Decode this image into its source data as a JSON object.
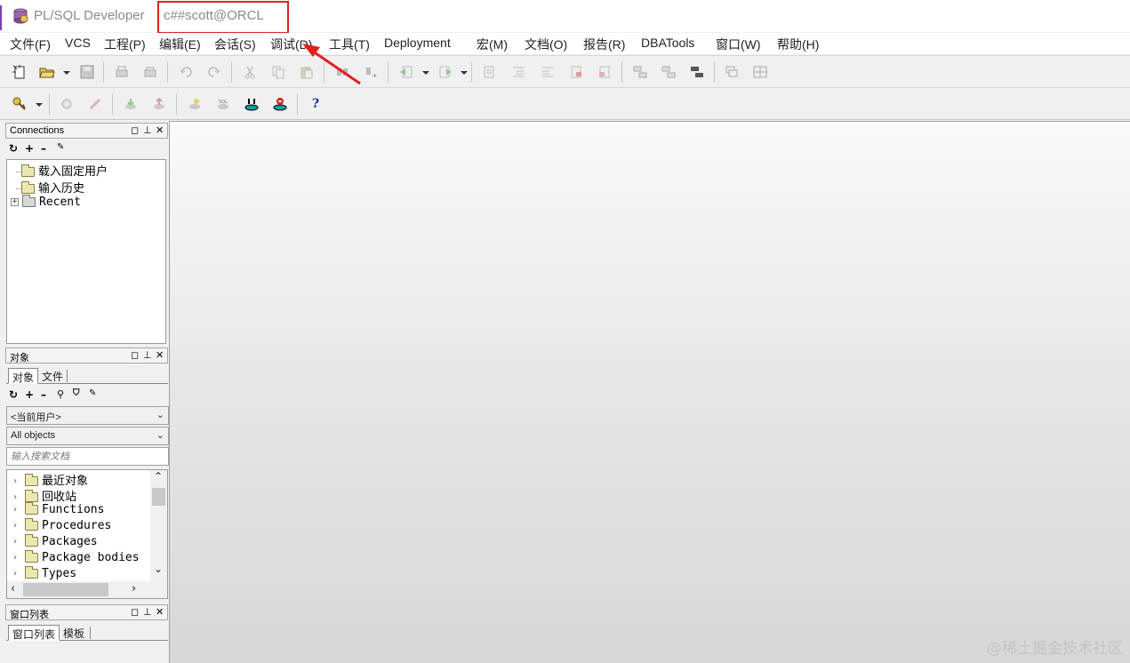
{
  "title_bar": {
    "app_title": "PL/SQL Developer",
    "connection": "c##scott@ORCL",
    "highlight_color": "#e02020"
  },
  "menu": [
    {
      "label": "文件(F)"
    },
    {
      "label": "VCS"
    },
    {
      "label": "工程(P)"
    },
    {
      "label": "编辑(E)"
    },
    {
      "label": "会话(S)"
    },
    {
      "label": "调试(D)"
    },
    {
      "label": "工具(T)"
    },
    {
      "label": "Deployment"
    },
    {
      "label": "宏(M)"
    },
    {
      "label": "文档(O)"
    },
    {
      "label": "报告(R)"
    },
    {
      "label": "DBATools"
    },
    {
      "label": "窗口(W)"
    },
    {
      "label": "帮助(H)"
    }
  ],
  "toolbar_icons": {
    "row1": [
      "new-icon",
      "open-icon",
      "save-icon",
      "print-icon",
      "print-preview-icon",
      "undo-icon",
      "redo-icon",
      "cut-icon",
      "copy-icon",
      "paste-icon",
      "find-icon",
      "replace-icon",
      "back-icon",
      "forward-icon",
      "document-icons",
      "window-icons"
    ],
    "row2": [
      "key-icon",
      "execute-icon",
      "break-icon",
      "commit-icon",
      "rollback-icon",
      "explain-icon",
      "sql-icon",
      "connect-icon",
      "disconnect-icon",
      "help-icon"
    ],
    "help_glyph": "?"
  },
  "connections_panel": {
    "title": "Connections",
    "controls": [
      "◻",
      "⊥",
      "✕"
    ],
    "items": [
      {
        "label": "载入固定用户",
        "type": "folder"
      },
      {
        "label": "输入历史",
        "type": "folder"
      },
      {
        "label": "Recent",
        "type": "folder-gray",
        "expander": "+"
      }
    ]
  },
  "objects_panel": {
    "title": "对象",
    "tabs": [
      {
        "label": "对象",
        "active": true
      },
      {
        "label": "文件",
        "active": false
      }
    ],
    "user_combo": "<当前用户>",
    "filter_combo": "All objects",
    "search_placeholder": "输入搜索文档",
    "items": [
      {
        "label": "最近对象"
      },
      {
        "label": "回收站"
      },
      {
        "label": "Functions"
      },
      {
        "label": "Procedures"
      },
      {
        "label": "Packages"
      },
      {
        "label": "Package bodies"
      },
      {
        "label": "Types"
      }
    ]
  },
  "window_list_panel": {
    "title": "窗口列表",
    "tabs": [
      {
        "label": "窗口列表",
        "active": true
      },
      {
        "label": "模板",
        "active": false
      }
    ]
  },
  "watermark": "@稀土掘金技术社区"
}
